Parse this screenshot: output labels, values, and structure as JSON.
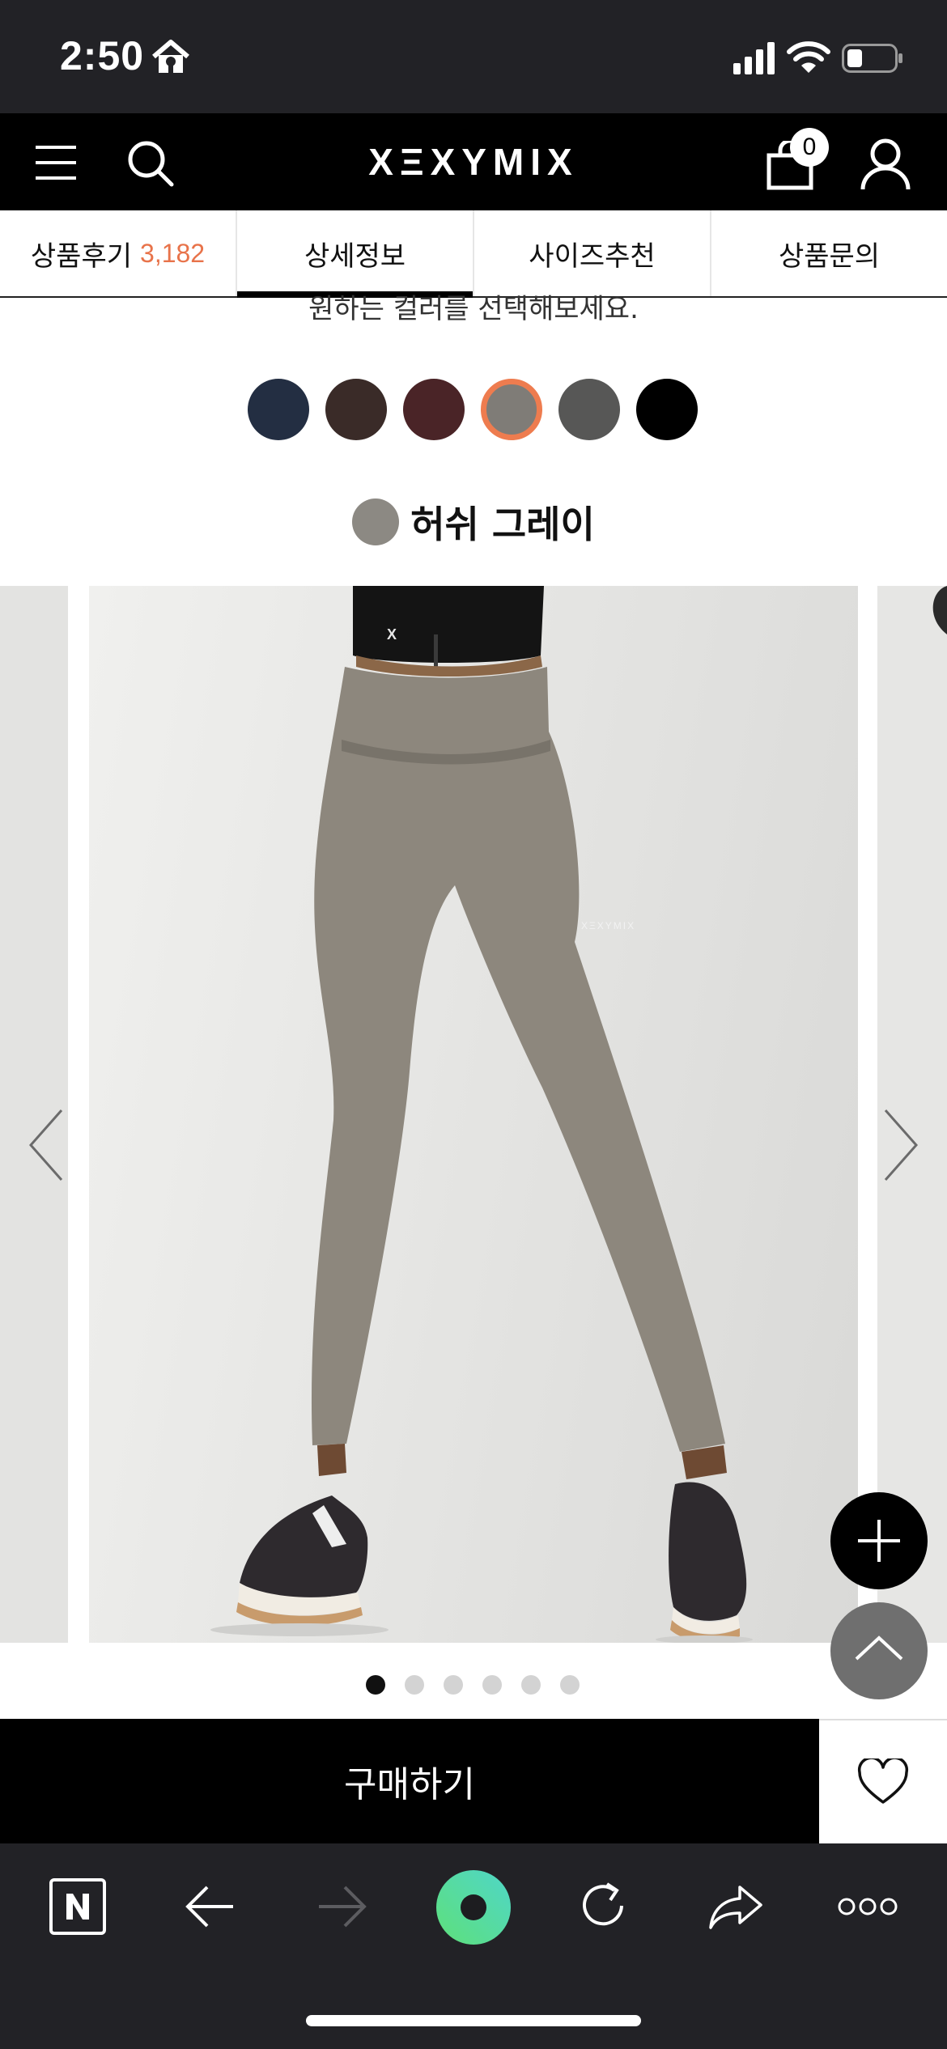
{
  "status_bar": {
    "time": "2:50"
  },
  "header": {
    "brand": "XΞXYMIX",
    "cart_count": "0"
  },
  "tabs": [
    {
      "label": "상품후기",
      "count": "3,182"
    },
    {
      "label": "상세정보"
    },
    {
      "label": "사이즈추천"
    },
    {
      "label": "상품문의"
    }
  ],
  "active_tab": "상세정보",
  "color_select": {
    "prompt": "원하는 컬러를 선택해보세요.",
    "swatches": [
      "#232e42",
      "#3a2b28",
      "#4a2427",
      "#7f7c77",
      "#575756",
      "#000000"
    ],
    "selected_index": 3,
    "selected_name": "허쉬 그레이",
    "selected_color": "#8c8983"
  },
  "gallery": {
    "slide_count": 6,
    "active_slide": 1,
    "product_print": "XΞXYMIX"
  },
  "purchase": {
    "buy_label": "구매하기"
  },
  "colors": {
    "accent": "#e8734a",
    "selected_ring": "#ee7c4f",
    "legging": "#8d877d"
  }
}
